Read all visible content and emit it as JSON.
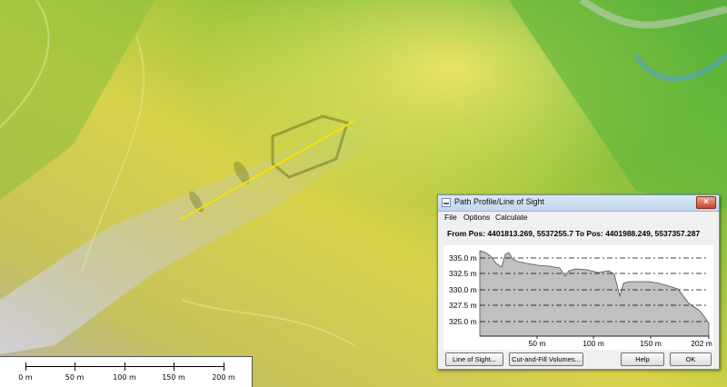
{
  "dialog": {
    "title": "Path Profile/Line of Sight",
    "close_label": "×",
    "menu": [
      "File",
      "Options",
      "Calculate"
    ],
    "position_text": "From Pos: 4401813.269, 5537255.7 To Pos: 4401988.249, 5537357.287",
    "buttons": {
      "line_of_sight": "Line of Sight...",
      "cut_fill": "Cut-and-Fill Volumes...",
      "help": "Help",
      "ok": "OK"
    }
  },
  "profile": {
    "y_ticks": [
      "335.0 m",
      "332.5 m",
      "330.0 m",
      "327.5 m",
      "325.0 m"
    ],
    "x_ticks": [
      "50 m",
      "100 m",
      "150 m",
      "202 m"
    ],
    "fill_color": "#c0c0c0"
  },
  "scale_bar": {
    "labels": [
      "0 m",
      "50 m",
      "100 m",
      "150 m",
      "200 m"
    ]
  },
  "map": {
    "line_color": "#f2e400"
  }
}
